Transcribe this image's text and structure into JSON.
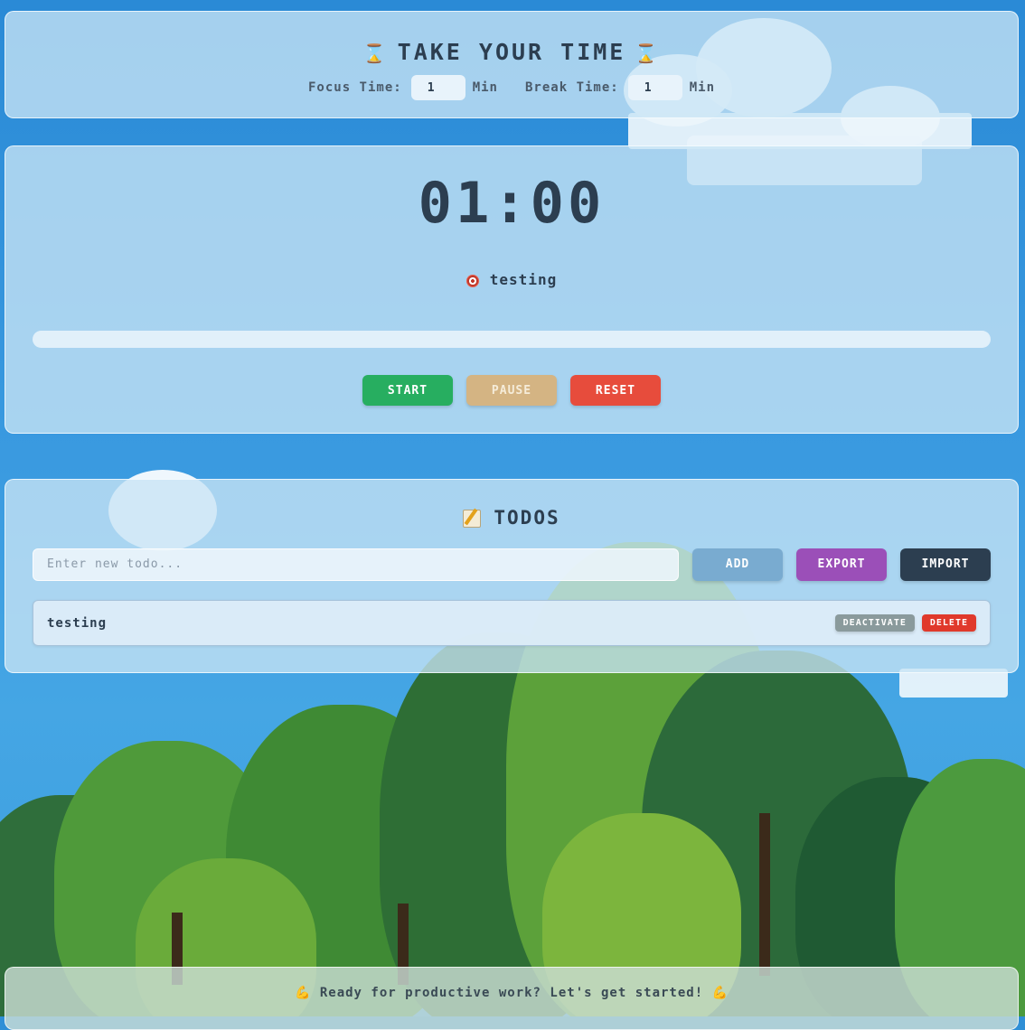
{
  "header": {
    "title": "TAKE YOUR TIME",
    "title_icon": "hourglass-icon",
    "focus_label": "Focus Time:",
    "focus_value": "1",
    "focus_unit": "Min",
    "break_label": "Break Time:",
    "break_value": "1",
    "break_unit": "Min"
  },
  "timer": {
    "display": "01:00",
    "task_icon": "target-icon",
    "current_task": "testing",
    "progress": 0,
    "start_label": "START",
    "pause_label": "PAUSE",
    "reset_label": "RESET"
  },
  "todos": {
    "title": "TODOS",
    "title_icon": "memo-icon",
    "input_placeholder": "Enter new todo...",
    "add_label": "ADD",
    "export_label": "EXPORT",
    "import_label": "IMPORT",
    "items": [
      {
        "text": "testing",
        "deactivate_label": "DEACTIVATE",
        "delete_label": "DELETE"
      }
    ]
  },
  "footer": {
    "message": "Ready for productive work? Let's get started!",
    "icon": "flexed-biceps-icon"
  },
  "colors": {
    "start": "#27ae60",
    "pause": "#d4b483",
    "reset": "#e74c3c",
    "add": "#79abd0",
    "export": "#9b4fb8",
    "import": "#2c3e50",
    "deactivate": "#8a9a9c",
    "delete": "#e0392b"
  }
}
